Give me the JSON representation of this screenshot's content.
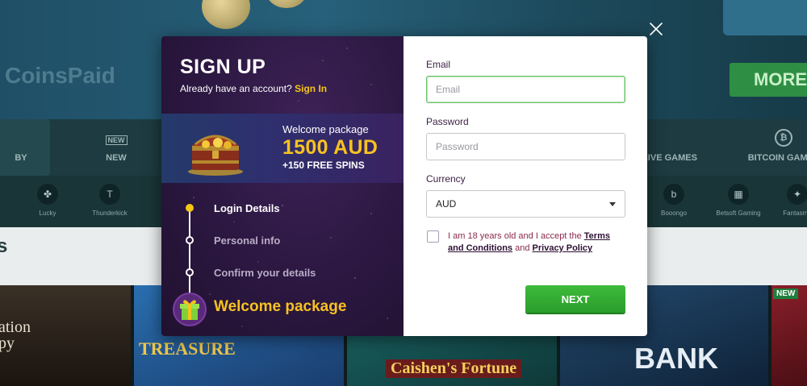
{
  "background": {
    "brand_text": "CoinsPaid",
    "more_button": "MORE",
    "categories": [
      {
        "label": "BY"
      },
      {
        "label": "NEW"
      },
      {
        "label": "LIVE GAMES"
      },
      {
        "label": "BITCOIN GAMES"
      }
    ],
    "providers": [
      {
        "label": "Lucky"
      },
      {
        "label": "Thunderkick"
      },
      {
        "label": "Booongo"
      },
      {
        "label": "Betsoft Gaming"
      },
      {
        "label": "Fantasma"
      }
    ],
    "section_title": "s",
    "games": [
      {
        "title": "ation\npy"
      },
      {
        "title": "TREASURE"
      },
      {
        "title": "Caishen's Fortune"
      },
      {
        "title": "BANK"
      },
      {
        "title": "NEW"
      }
    ],
    "new_badge": "NEW"
  },
  "modal": {
    "title": "SIGN UP",
    "account_prompt": "Already have an account?",
    "signin_link": "Sign In",
    "promo": {
      "label": "Welcome package",
      "amount": "1500 AUD",
      "spins": "+150 FREE SPINS"
    },
    "steps": [
      {
        "label": "Login Details",
        "active": true
      },
      {
        "label": "Personal info",
        "active": false
      },
      {
        "label": "Confirm your details",
        "active": false
      }
    ],
    "welcome_title": "Welcome package",
    "form": {
      "email_label": "Email",
      "email_placeholder": "Email",
      "email_value": "",
      "password_label": "Password",
      "password_placeholder": "Password",
      "currency_label": "Currency",
      "currency_value": "AUD",
      "terms_prefix": "I am 18 years old and I accept the",
      "terms_link": "Terms and Conditions",
      "terms_and": "and",
      "privacy_link": "Privacy Policy",
      "next_label": "NEXT"
    }
  },
  "colors": {
    "accent_gold": "#f7c221",
    "next_green": "#35ad33",
    "modal_purple": "#2b1740"
  }
}
